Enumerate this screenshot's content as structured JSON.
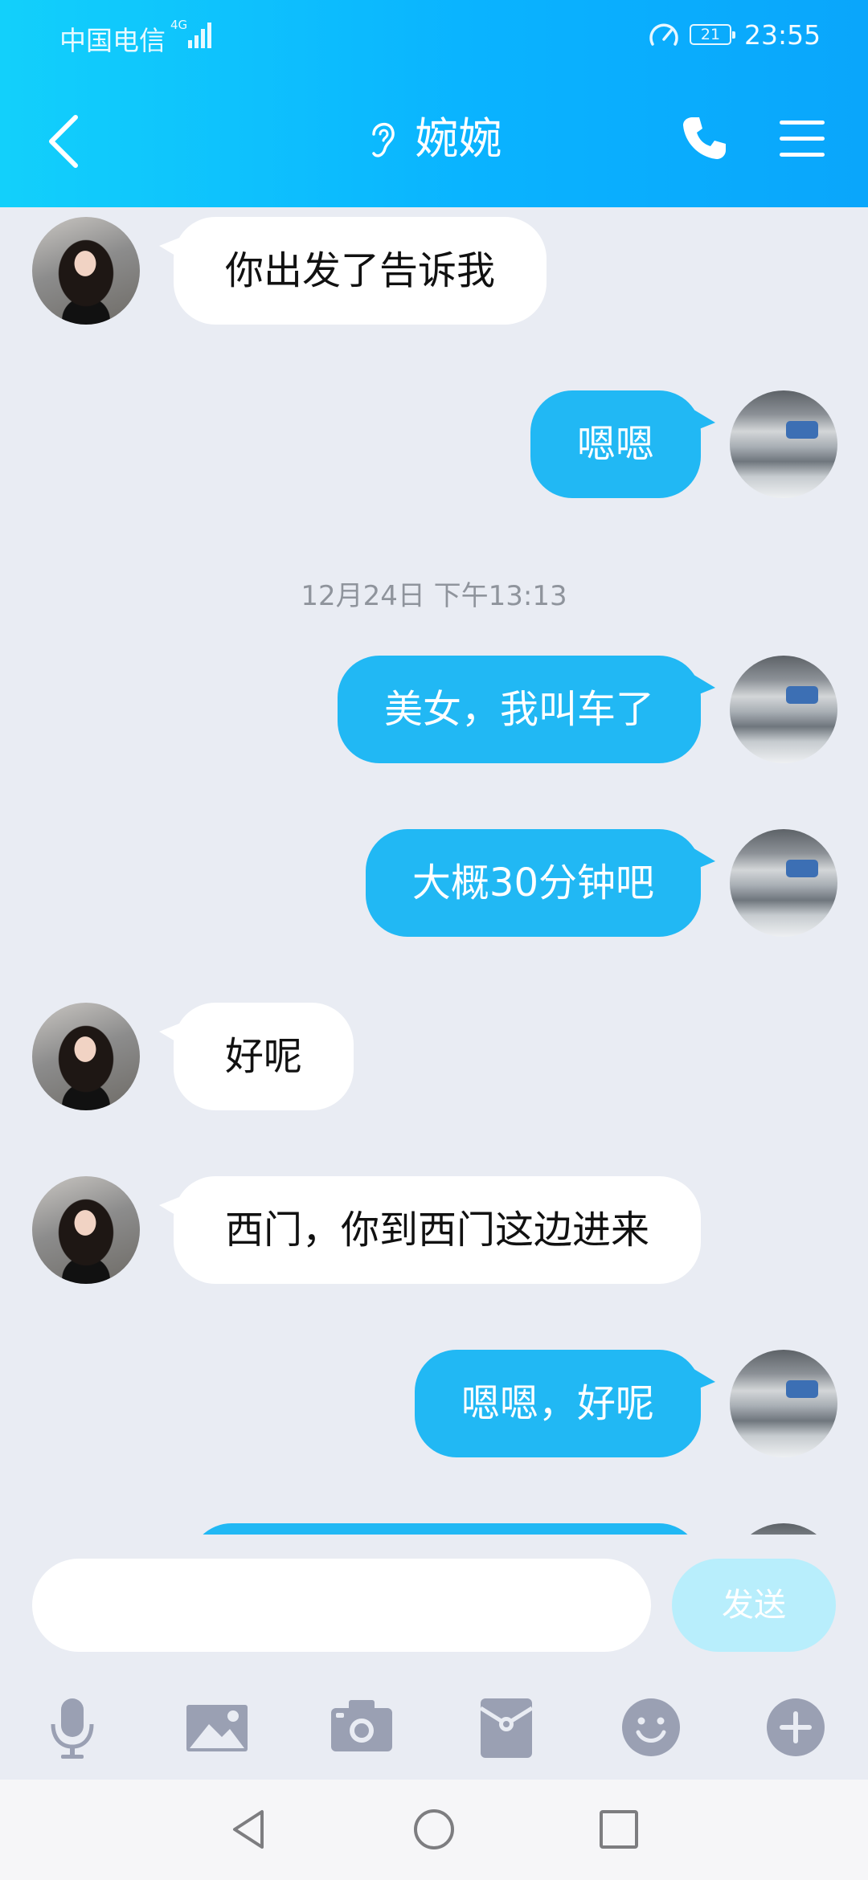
{
  "status_bar": {
    "carrier": "中国电信",
    "network": "4G",
    "battery": "21",
    "time": "23:55"
  },
  "header": {
    "title": "婉婉"
  },
  "messages": [
    {
      "from": "contact",
      "text": "你出发了告诉我"
    },
    {
      "from": "me",
      "text": "嗯嗯"
    },
    {
      "type": "timestamp",
      "text": "12月24日 下午13:13"
    },
    {
      "from": "me",
      "text": "美女，我叫车了"
    },
    {
      "from": "me",
      "text": "大概30分钟吧"
    },
    {
      "from": "contact",
      "text": "好呢"
    },
    {
      "from": "contact",
      "text": "西门，你到西门这边进来"
    },
    {
      "from": "me",
      "text": "嗯嗯，好呢"
    }
  ],
  "composer": {
    "input_value": "",
    "send_label": "发送"
  },
  "toolbar_icons": [
    "microphone-icon",
    "image-icon",
    "camera-icon",
    "red-packet-icon",
    "emoji-icon",
    "plus-icon"
  ],
  "nav_icons": [
    "back-triangle-icon",
    "home-circle-icon",
    "recents-square-icon"
  ],
  "colors": {
    "header_start": "#12d0fb",
    "header_end": "#0aa6fb",
    "bubble_out": "#21b8f4",
    "bubble_in": "#ffffff",
    "chat_bg": "#e9ecf3",
    "send_button": "#b8eefc",
    "toolbar_icon": "#9aa0b3"
  }
}
